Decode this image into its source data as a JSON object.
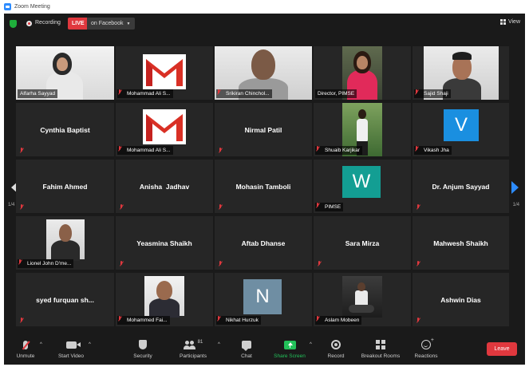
{
  "window": {
    "title": "Zoom Meeting"
  },
  "topbar": {
    "recording_label": "Recording",
    "live_badge": "LIVE",
    "live_destination": "on Facebook",
    "view_label": "View"
  },
  "pagination": {
    "left_page": "1/4",
    "right_page": "1/4"
  },
  "participants": [
    {
      "label": "Alfarha Sayyad",
      "kind": "video",
      "muted": false
    },
    {
      "label": "Mohammad Ali S...",
      "kind": "logo",
      "muted": true
    },
    {
      "label": "Srikiran Chinchol...",
      "kind": "video",
      "muted": true
    },
    {
      "label": "Director, PIMSE",
      "kind": "video",
      "muted": false
    },
    {
      "label": "Sajid Shaji",
      "kind": "video",
      "muted": true
    },
    {
      "label": "Cynthia Baptist",
      "kind": "name",
      "muted": true
    },
    {
      "label": "Mohammad Ali S...",
      "kind": "logo",
      "muted": true
    },
    {
      "label": "Nirmal Patil",
      "kind": "name",
      "muted": true
    },
    {
      "label": "Shuaib Karjikar",
      "kind": "video",
      "muted": true
    },
    {
      "label": "Vikash Jha",
      "kind": "avatar",
      "avatar_letter": "V",
      "avatar_color": "#1a8fe0",
      "muted": true
    },
    {
      "label": "Fahim Ahmed",
      "kind": "name",
      "muted": true
    },
    {
      "label": "Anisha  Jadhav",
      "kind": "name",
      "muted": true
    },
    {
      "label": "Mohasin Tamboli",
      "kind": "name",
      "muted": true
    },
    {
      "label": "PIMSE",
      "kind": "avatar",
      "avatar_letter": "W",
      "avatar_color": "#139e93",
      "muted": true
    },
    {
      "label": "Dr. Anjum Sayyad",
      "kind": "name",
      "muted": true
    },
    {
      "label": "Lionel John D'me...",
      "kind": "video",
      "muted": true
    },
    {
      "label": "Yeasmina Shaikh",
      "kind": "name",
      "muted": true
    },
    {
      "label": "Aftab Dhanse",
      "kind": "name",
      "muted": true
    },
    {
      "label": "Sara Mirza",
      "kind": "name",
      "muted": true
    },
    {
      "label": "Mahwesh Shaikh",
      "kind": "name",
      "muted": true
    },
    {
      "label": "syed furquan sh...",
      "kind": "name",
      "muted": true
    },
    {
      "label": "Mohammed Fai...",
      "kind": "video",
      "muted": true
    },
    {
      "label": "Nikhat Hurzuk",
      "kind": "avatar",
      "avatar_letter": "N",
      "avatar_color": "#6f8ea3",
      "muted": true
    },
    {
      "label": "Aslam Mobeen",
      "kind": "video",
      "muted": true
    },
    {
      "label": "Ashwin Dias",
      "kind": "name",
      "muted": true
    }
  ],
  "toolbar": {
    "unmute": "Unmute",
    "start_video": "Start Video",
    "security": "Security",
    "participants": "Participants",
    "participants_count": "81",
    "chat": "Chat",
    "share_screen": "Share Screen",
    "record": "Record",
    "breakout_rooms": "Breakout Rooms",
    "reactions": "Reactions",
    "leave": "Leave"
  },
  "colors": {
    "meeting_bg": "#1a1a1a",
    "tile_bg": "#262626",
    "live_red": "#e0383e",
    "share_green": "#23c15a",
    "active_speaker": "#d8d84a",
    "zoom_blue": "#2d8cff"
  }
}
